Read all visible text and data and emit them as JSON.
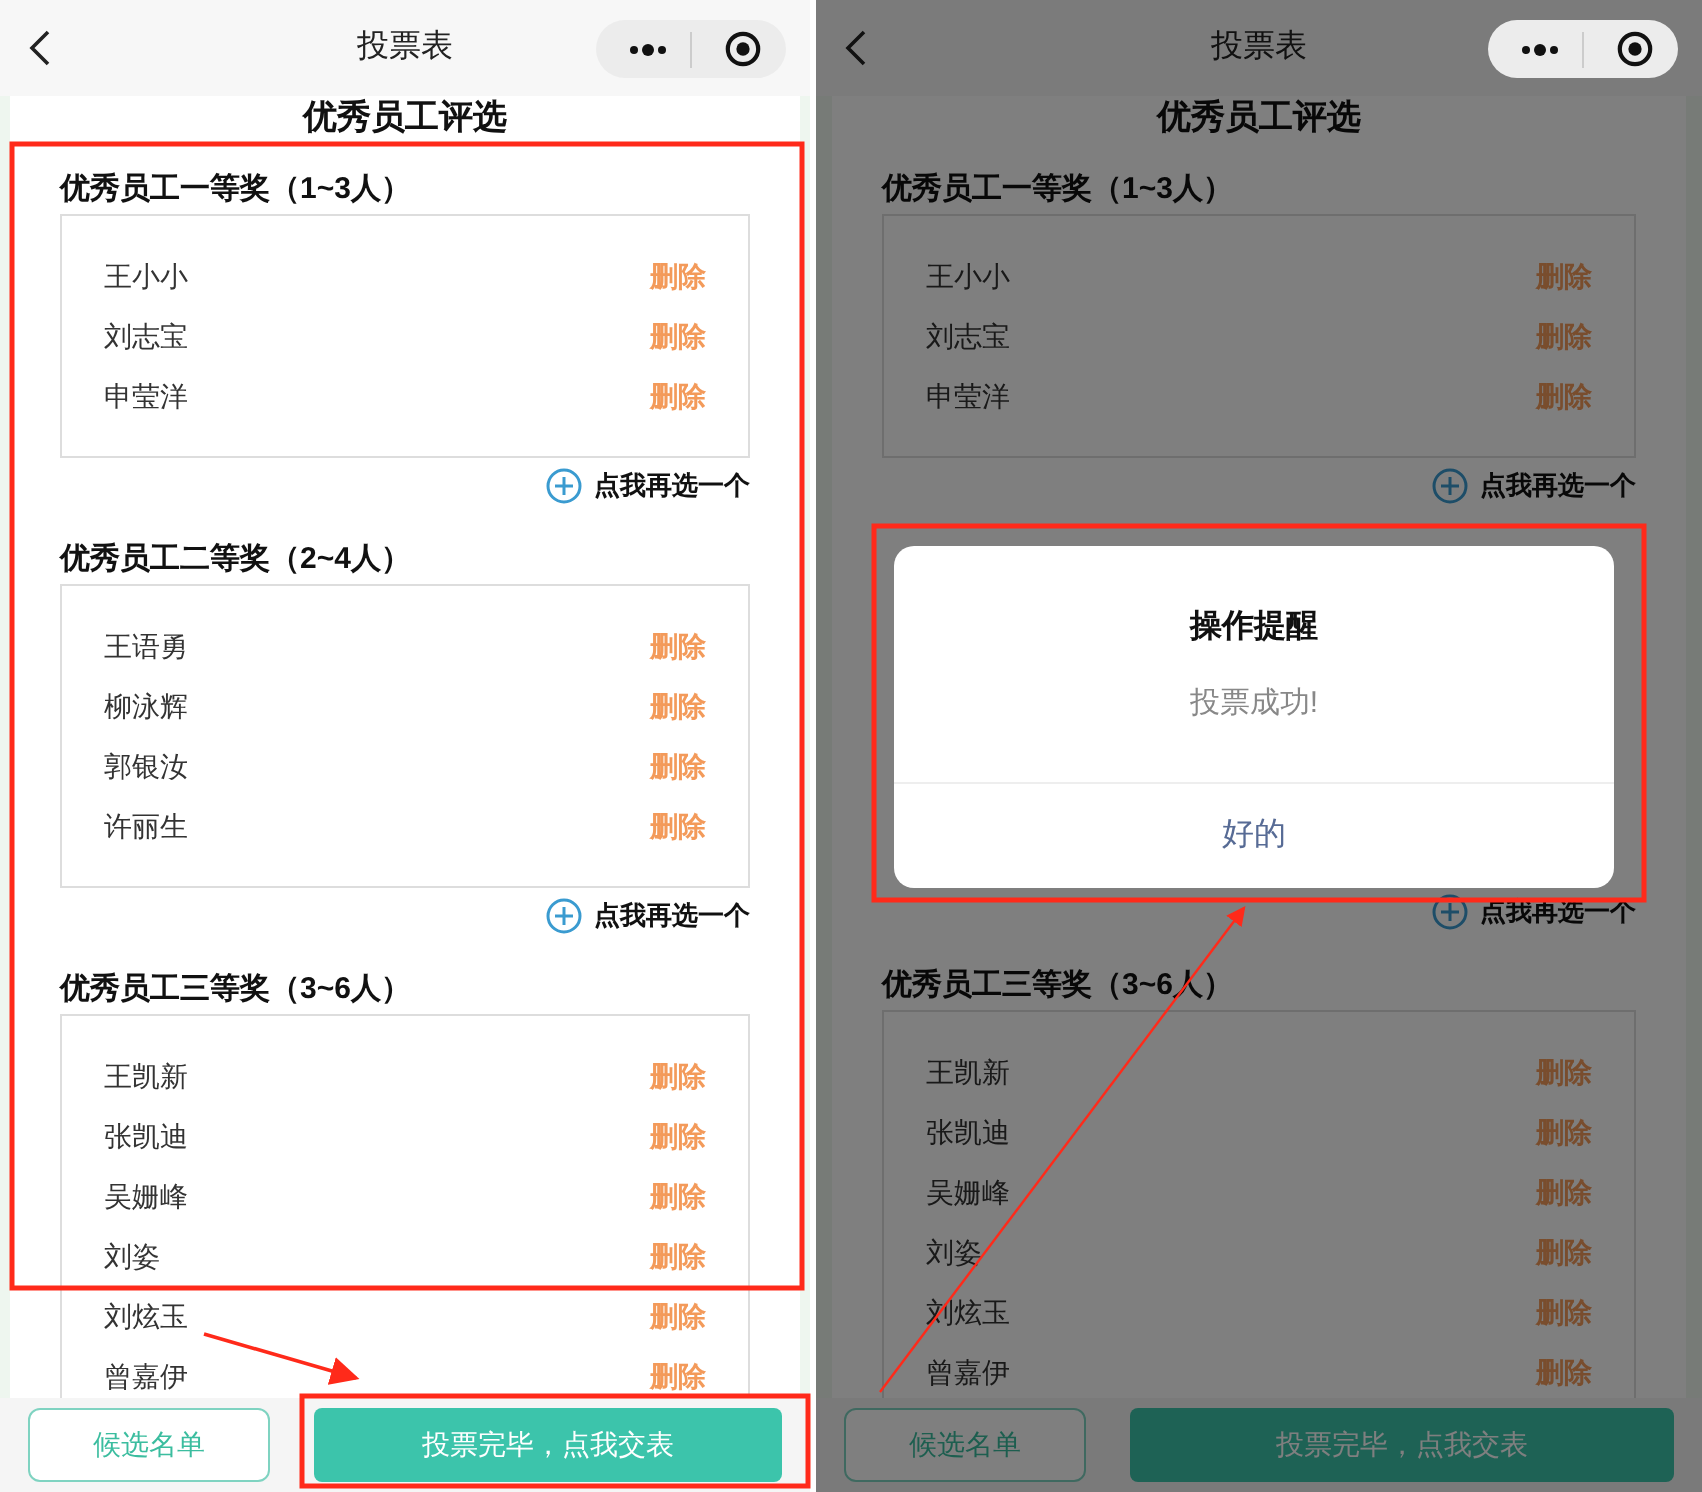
{
  "screens": [
    {
      "header": {
        "title": "投票表"
      },
      "heading": "优秀员工评选",
      "groups": [
        {
          "heading": "优秀员工一等奖（1~3人）",
          "rows": [
            {
              "name": "王小小",
              "action": "删除"
            },
            {
              "name": "刘志宝",
              "action": "删除"
            },
            {
              "name": "申莹洋",
              "action": "删除"
            }
          ],
          "add_more": "点我再选一个"
        },
        {
          "heading": "优秀员工二等奖（2~4人）",
          "rows": [
            {
              "name": "王语勇",
              "action": "删除"
            },
            {
              "name": "柳泳辉",
              "action": "删除"
            },
            {
              "name": "郭银汝",
              "action": "删除"
            },
            {
              "name": "许丽生",
              "action": "删除"
            }
          ],
          "add_more": "点我再选一个"
        },
        {
          "heading": "优秀员工三等奖（3~6人）",
          "rows": [
            {
              "name": "王凯新",
              "action": "删除"
            },
            {
              "name": "张凯迪",
              "action": "删除"
            },
            {
              "name": "吴姗峰",
              "action": "删除"
            },
            {
              "name": "刘姿",
              "action": "删除"
            },
            {
              "name": "刘炫玉",
              "action": "删除"
            },
            {
              "name": "曾嘉伊",
              "action": "删除"
            }
          ]
        }
      ],
      "footer": {
        "secondary": "候选名单",
        "primary": "投票完毕，点我交表"
      }
    },
    {
      "header": {
        "title": "投票表"
      },
      "heading": "优秀员工评选",
      "groups": [
        {
          "heading": "优秀员工一等奖（1~3人）",
          "rows": [
            {
              "name": "王小小",
              "action": "删除"
            },
            {
              "name": "刘志宝",
              "action": "删除"
            },
            {
              "name": "申莹洋",
              "action": "删除"
            }
          ],
          "add_more": "点我再选一个"
        },
        {
          "add_more": "点我再选一个"
        },
        {
          "heading": "优秀员工三等奖（3~6人）",
          "rows": [
            {
              "name": "王凯新",
              "action": "删除"
            },
            {
              "name": "张凯迪",
              "action": "删除"
            },
            {
              "name": "吴姗峰",
              "action": "删除"
            },
            {
              "name": "刘姿",
              "action": "删除"
            },
            {
              "name": "刘炫玉",
              "action": "删除"
            },
            {
              "name": "曾嘉伊",
              "action": "删除"
            }
          ]
        }
      ],
      "footer": {
        "secondary": "候选名单",
        "primary": "投票完毕，点我交表"
      },
      "dialog": {
        "title": "操作提醒",
        "message": "投票成功!",
        "button": "好的"
      }
    }
  ]
}
